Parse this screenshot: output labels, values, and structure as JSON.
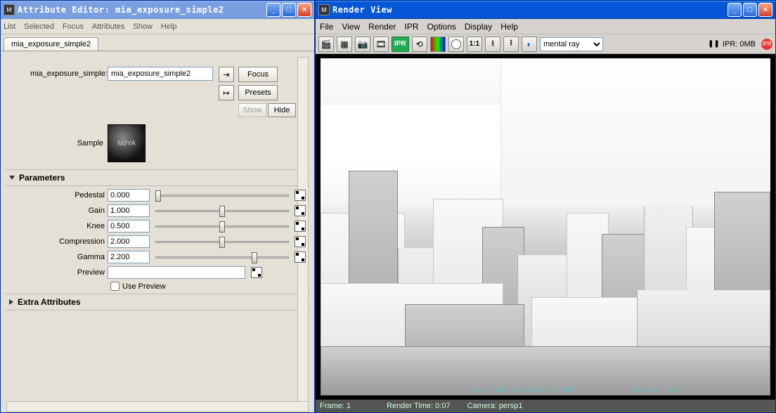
{
  "attr_window": {
    "title": "Attribute Editor: mia_exposure_simple2",
    "menus": [
      "List",
      "Selected",
      "Focus",
      "Attributes",
      "Show",
      "Help"
    ],
    "tab_label": "mia_exposure_simple2",
    "node_type_label": "mia_exposure_simple:",
    "node_name_value": "mia_exposure_simple2",
    "btn_focus": "Focus",
    "btn_presets": "Presets",
    "btn_show": "Show",
    "btn_hide": "Hide",
    "sample_label": "Sample",
    "sample_logo": "M∂YA",
    "section_parameters": "Parameters",
    "section_extra": "Extra Attributes",
    "params": {
      "pedestal": {
        "label": "Pedestal",
        "value": "0.000",
        "pos": 0
      },
      "gain": {
        "label": "Gain",
        "value": "1.000",
        "pos": 50
      },
      "knee": {
        "label": "Knee",
        "value": "0.500",
        "pos": 50
      },
      "compression": {
        "label": "Compression",
        "value": "2.000",
        "pos": 50
      },
      "gamma": {
        "label": "Gamma",
        "value": "2.200",
        "pos": 72
      },
      "preview": {
        "label": "Preview",
        "value": ""
      }
    },
    "use_preview_label": "Use Preview",
    "use_preview_checked": false
  },
  "render_window": {
    "title": "Render View",
    "menus": [
      "File",
      "View",
      "Render",
      "IPR",
      "Options",
      "Display",
      "Help"
    ],
    "renderer_selected": "mental ray",
    "ipr_pause": "❚❚",
    "ipr_label": "IPR: 0MB",
    "ipr_badge": "IPR",
    "status": {
      "frame": "Frame: 1",
      "size": "size:  640  480 zoom: 1.000",
      "engine": "(mental ray)",
      "render_time": "Render Time: 0:07",
      "camera": "Camera: persp1"
    },
    "one_to_one": "1:1"
  }
}
